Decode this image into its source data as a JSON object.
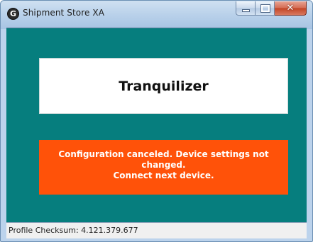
{
  "window": {
    "title": "Shipment Store XA",
    "icon": "app-logo-icon",
    "close_glyph": "✕"
  },
  "product": {
    "name": "Tranquilizer"
  },
  "message": {
    "line1": "Configuration canceled. Device settings not",
    "line2": "changed.",
    "line3": "Connect next device.",
    "background_color": "#ff5209"
  },
  "status_bar": {
    "text": "Profile Checksum: 4.121.379.677"
  },
  "colors": {
    "client_background": "#067e7e",
    "message_background": "#ff5209",
    "product_background": "#ffffff"
  }
}
